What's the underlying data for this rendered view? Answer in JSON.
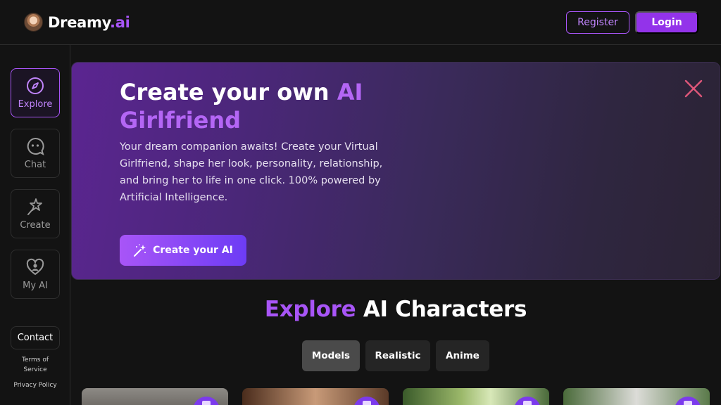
{
  "header": {
    "brand_name": "Dreamy",
    "brand_suffix": ".ai",
    "register_label": "Register",
    "login_label": "Login"
  },
  "sidebar": {
    "items": [
      {
        "label": "Explore",
        "icon": "compass-icon",
        "active": true
      },
      {
        "label": "Chat",
        "icon": "chat-bubble-icon",
        "active": false
      },
      {
        "label": "Create",
        "icon": "magic-wand-icon",
        "active": false
      },
      {
        "label": "My AI",
        "icon": "heart-person-icon",
        "active": false
      }
    ],
    "contact_label": "Contact",
    "terms_label": "Terms of Service",
    "privacy_label": "Privacy Policy"
  },
  "hero": {
    "title_part1": "Create your own ",
    "title_highlight": "AI Girlfriend",
    "description": "Your dream companion awaits! Create your Virtual Girlfriend, shape her look, personality, relationship, and bring her to life in one click. 100% powered by Artificial Intelligence.",
    "cta_label": "Create your AI"
  },
  "explore": {
    "title_highlight": "Explore",
    "title_rest": " AI Characters",
    "tabs": [
      {
        "label": "Models",
        "active": true
      },
      {
        "label": "Realistic",
        "active": false
      },
      {
        "label": "Anime",
        "active": false
      }
    ]
  },
  "colors": {
    "accent": "#a855f7",
    "background": "#131313"
  }
}
